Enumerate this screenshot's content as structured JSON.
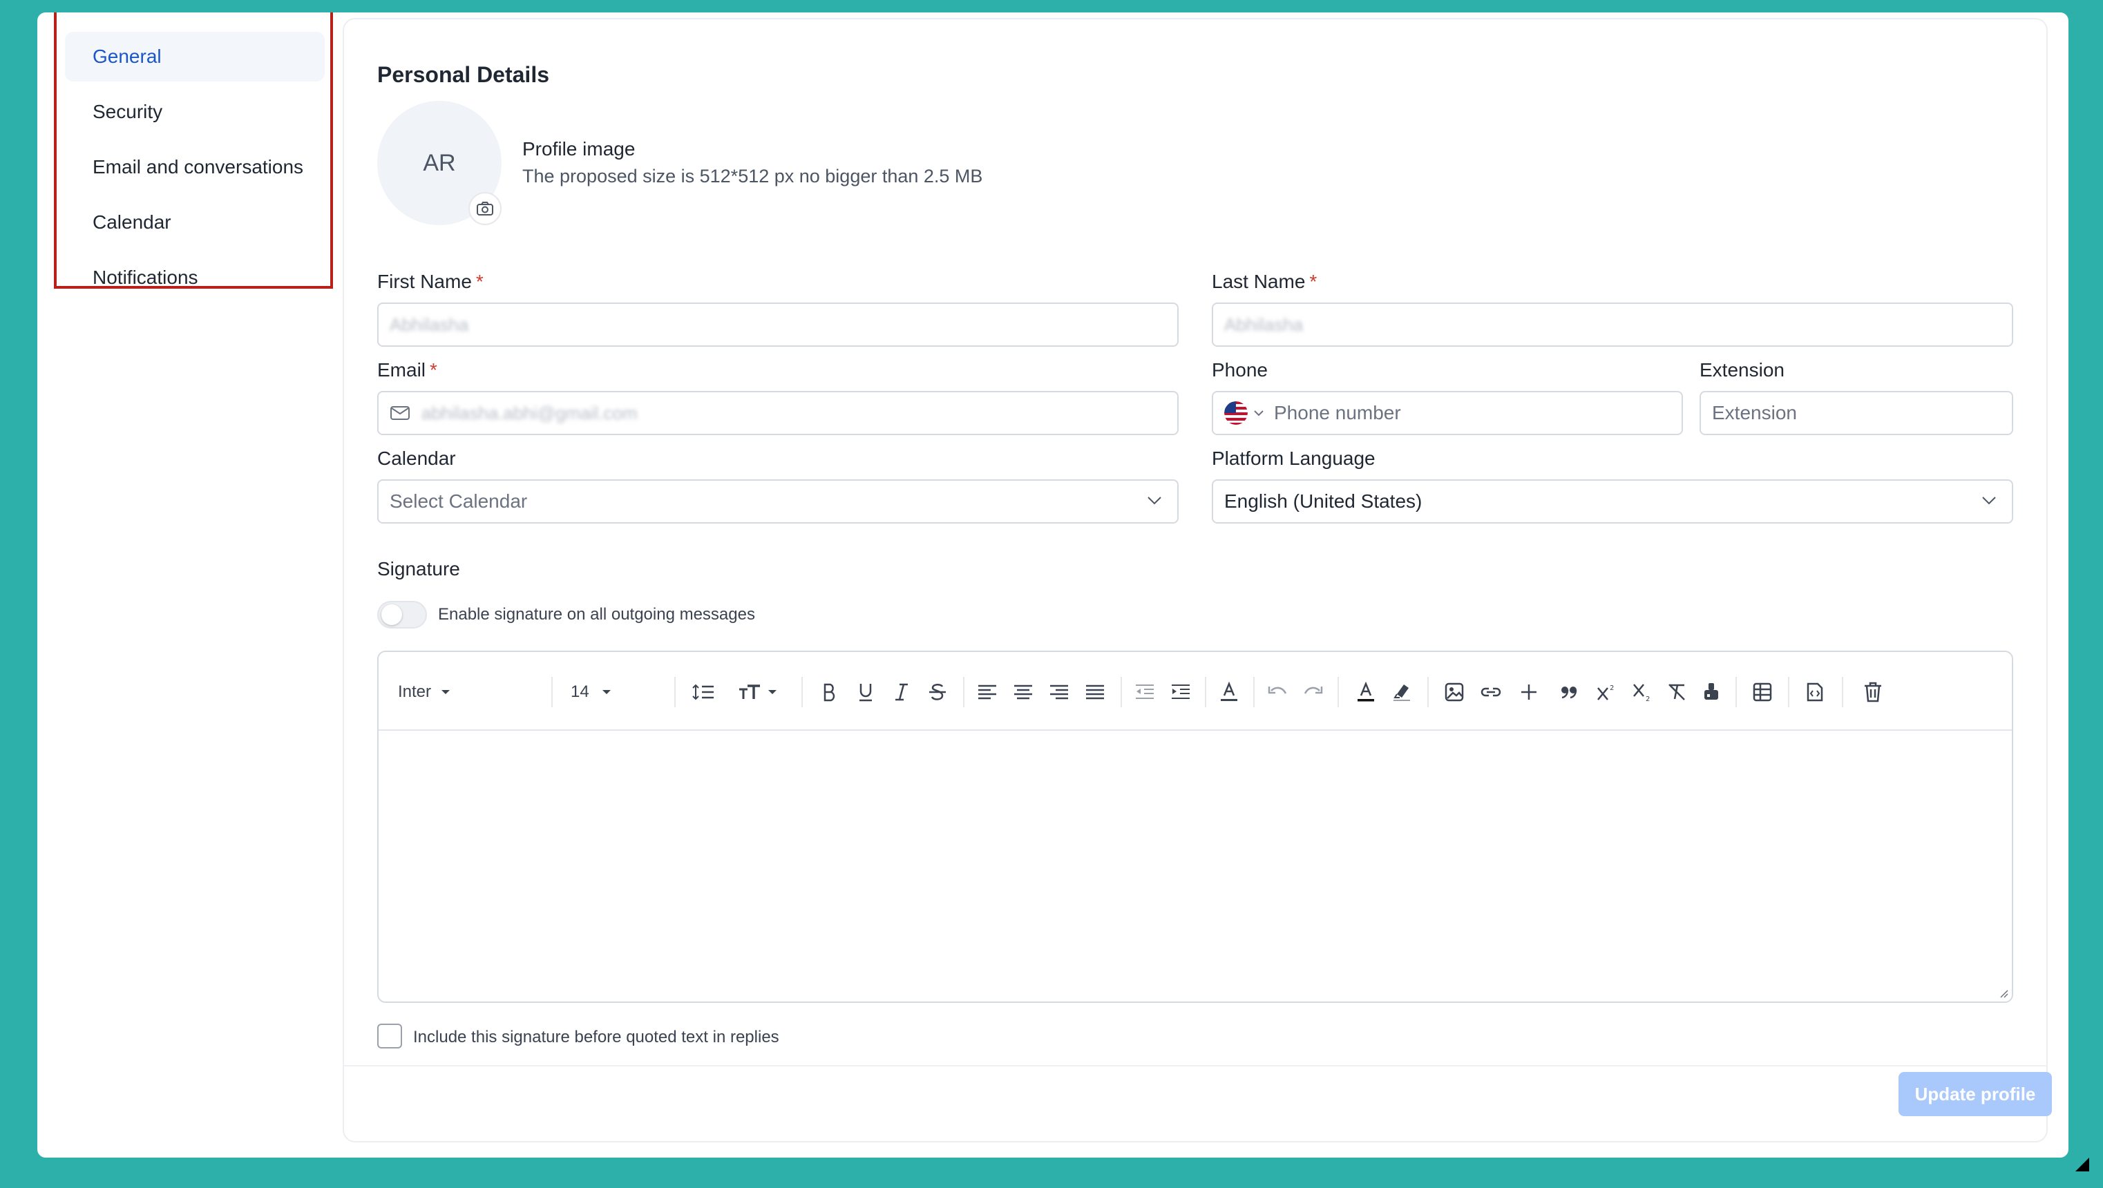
{
  "sidebar": {
    "items": [
      {
        "label": "General",
        "active": true
      },
      {
        "label": "Security"
      },
      {
        "label": "Email and conversations"
      },
      {
        "label": "Calendar"
      },
      {
        "label": "Notifications"
      }
    ]
  },
  "personal": {
    "title": "Personal Details",
    "avatar_initials": "AR",
    "profile_image_title": "Profile image",
    "profile_image_hint": "The proposed size is 512*512 px no bigger than 2.5 MB"
  },
  "form": {
    "first_name": {
      "label": "First Name",
      "required": "*",
      "value": "Abhilasha"
    },
    "last_name": {
      "label": "Last Name",
      "required": "*",
      "value": "Abhilasha"
    },
    "email": {
      "label": "Email",
      "required": "*",
      "value": "abhilasha.abhi@gmail.com"
    },
    "phone": {
      "label": "Phone",
      "placeholder": "Phone number",
      "country": "US"
    },
    "extension": {
      "label": "Extension",
      "placeholder": "Extension"
    },
    "calendar": {
      "label": "Calendar",
      "placeholder": "Select Calendar"
    },
    "language": {
      "label": "Platform Language",
      "value": "English (United States)"
    }
  },
  "signature": {
    "label": "Signature",
    "toggle_label": "Enable signature on all outgoing messages",
    "toggle_on": false,
    "font": "Inter",
    "font_size": "14",
    "include_label": "Include this signature before quoted text in replies"
  },
  "toolbar_icons": [
    "line-height-icon",
    "text-size-icon",
    "bold-icon",
    "underline-icon",
    "italic-icon",
    "strikethrough-icon",
    "align-left-icon",
    "align-center-icon",
    "align-right-icon",
    "align-justify-icon",
    "outdent-icon",
    "indent-icon",
    "font-color-icon",
    "undo-icon",
    "redo-icon",
    "text-color-icon",
    "highlight-icon",
    "image-icon",
    "link-icon",
    "plus-icon",
    "quote-icon",
    "superscript-icon",
    "subscript-icon",
    "clear-format-icon",
    "paint-format-icon",
    "table-icon",
    "code-file-icon",
    "trash-icon"
  ],
  "actions": {
    "update_label": "Update profile"
  },
  "colors": {
    "accent": "#1a56c9",
    "highlight_border": "#b8211b",
    "background": "#2db0a9",
    "button_disabled": "#a9c8fb"
  }
}
